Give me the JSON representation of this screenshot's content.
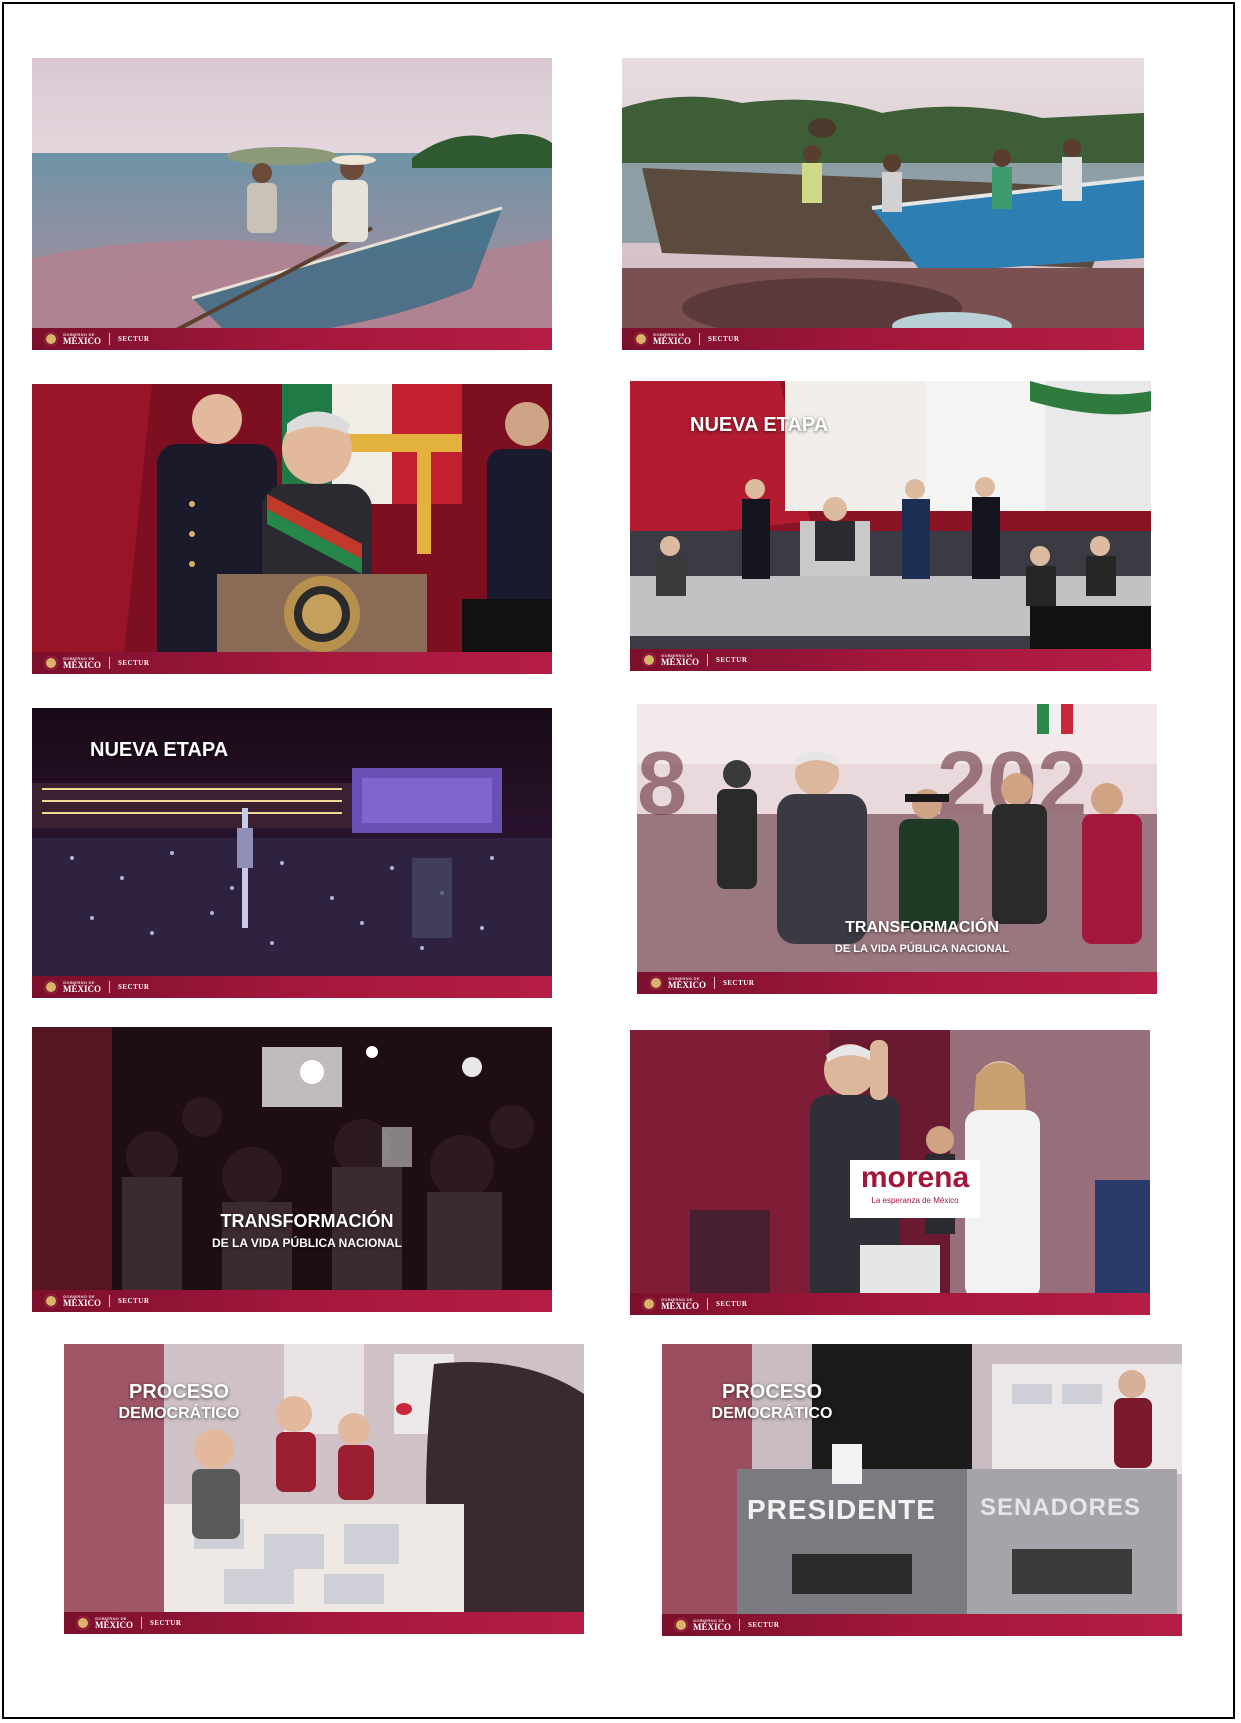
{
  "footer": {
    "gob_small": "GOBIERNO DE",
    "gob_big": "MÉXICO",
    "agency": "SECTUR"
  },
  "frames": [
    {
      "overlays": {}
    },
    {
      "overlays": {}
    },
    {
      "overlays": {}
    },
    {
      "overlays": {
        "headline": "NUEVA ETAPA"
      }
    },
    {
      "overlays": {
        "headline": "NUEVA ETAPA"
      }
    },
    {
      "overlays": {
        "headline": "TRANSFORMACIÓN",
        "subline": "DE LA VIDA PÚBLICA NACIONAL"
      }
    },
    {
      "overlays": {
        "headline": "TRANSFORMACIÓN",
        "subline": "DE LA VIDA PÚBLICA NACIONAL"
      }
    },
    {
      "overlays": {
        "sign": "morena",
        "sign_sub": "La esperanza de México"
      }
    },
    {
      "overlays": {
        "headline": "PROCESO",
        "subline": "DEMOCRÁTICO"
      }
    },
    {
      "overlays": {
        "headline": "PROCESO",
        "subline": "DEMOCRÁTICO",
        "box1": "PRESIDENTE",
        "box2": "SENADORES"
      }
    }
  ],
  "colors": {
    "footer_red": "#a3173d",
    "accent_gold": "#d9b36a"
  }
}
